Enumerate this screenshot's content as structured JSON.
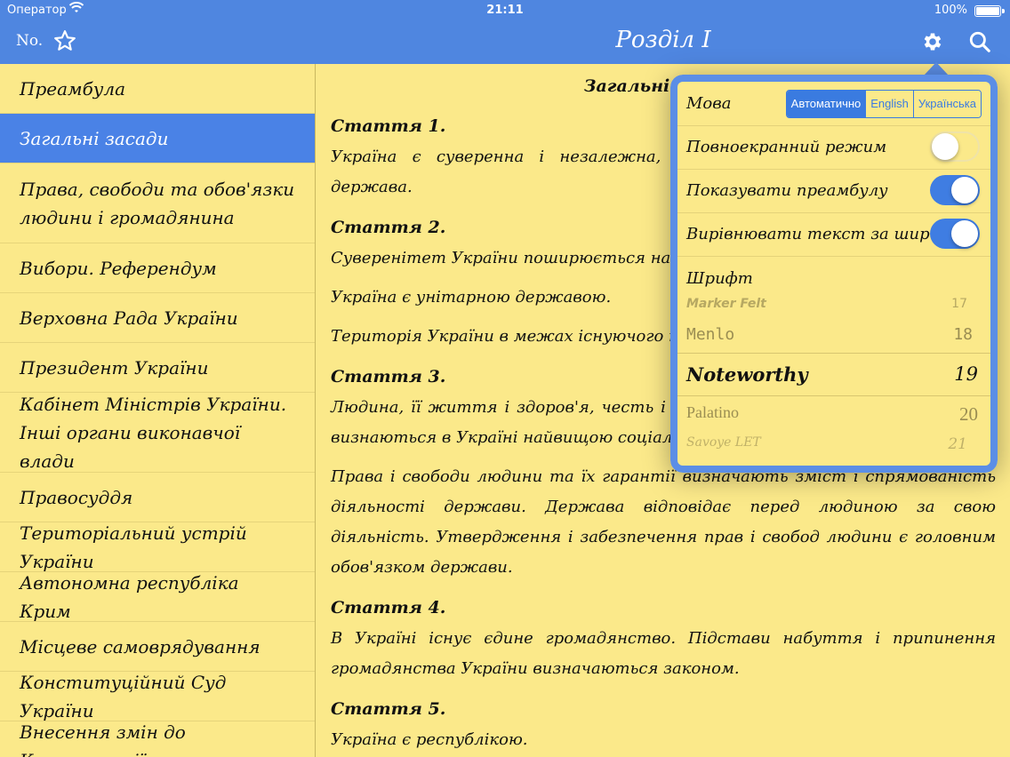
{
  "status": {
    "carrier": "Оператор",
    "time": "21:11",
    "battery": "100%"
  },
  "nav": {
    "number_label": "No.",
    "title": "Розділ I"
  },
  "sidebar": {
    "items": [
      {
        "label": "Преамбула",
        "active": false
      },
      {
        "label": "Загальні засади",
        "active": true
      },
      {
        "label": "Права, свободи та обов'язки людини і громадянина",
        "active": false
      },
      {
        "label": "Вибори. Референдум",
        "active": false
      },
      {
        "label": "Верховна Рада України",
        "active": false
      },
      {
        "label": "Президент України",
        "active": false
      },
      {
        "label": "Кабінет Міністрів України. Інші органи виконавчої влади",
        "active": false
      },
      {
        "label": "Правосуддя",
        "active": false
      },
      {
        "label": "Територіальний устрій України",
        "active": false
      },
      {
        "label": "Автономна республіка Крим",
        "active": false
      },
      {
        "label": "Місцеве самоврядування",
        "active": false
      },
      {
        "label": "Конституційний Суд України",
        "active": false
      },
      {
        "label": "Внесення змін до Конституції",
        "active": false
      }
    ]
  },
  "content": {
    "section_title": "Загальні засади",
    "article1": "Стаття 1.",
    "p1": "Україна є суверенна і незалежна, демократична, соціальна, правова держава.",
    "article2": "Стаття 2.",
    "p2": "Суверенітет України поширюється на всю її територію.",
    "p3": "Україна є унітарною державою.",
    "p4": "Територія України в межах існуючого кордону є цілісною і недоторканною.",
    "article3": "Стаття 3.",
    "p5": "Людина, її життя і здоров'я, честь і гідність, недоторканність і безпека визнаються в Україні найвищою соціальною цінністю.",
    "p6": "Права і свободи людини та їх гарантії визначають зміст і спрямованість діяльності держави. Держава відповідає перед людиною за свою діяльність. Утвердження і забезпечення прав і свобод людини є головним обов'язком держави.",
    "article4": "Стаття 4.",
    "p7": "В Україні існує єдине громадянство. Підстави набуття і припинення громадянства України визначаються законом.",
    "article5": "Стаття 5.",
    "p8": "Україна є республікою."
  },
  "settings": {
    "language_label": "Мова",
    "language_options": [
      "Автоматично",
      "English",
      "Українська"
    ],
    "language_selected": "Автоматично",
    "fullscreen_label": "Повноекранний режим",
    "fullscreen_on": false,
    "preamble_label": "Показувати преамбулу",
    "preamble_on": true,
    "justify_label": "Вирівнювати текст за шириною",
    "justify_on": true,
    "font_label": "Шрифт",
    "fonts": [
      {
        "name": "Marker Felt",
        "size": "17"
      },
      {
        "name": "Menlo",
        "size": "18"
      },
      {
        "name": "Noteworthy",
        "size": "19"
      },
      {
        "name": "Palatino",
        "size": "20"
      },
      {
        "name": "Savoye LET",
        "size": "21"
      }
    ],
    "font_selected": "Noteworthy"
  },
  "colors": {
    "accent": "#4a82e6",
    "background": "#fbe98a"
  }
}
